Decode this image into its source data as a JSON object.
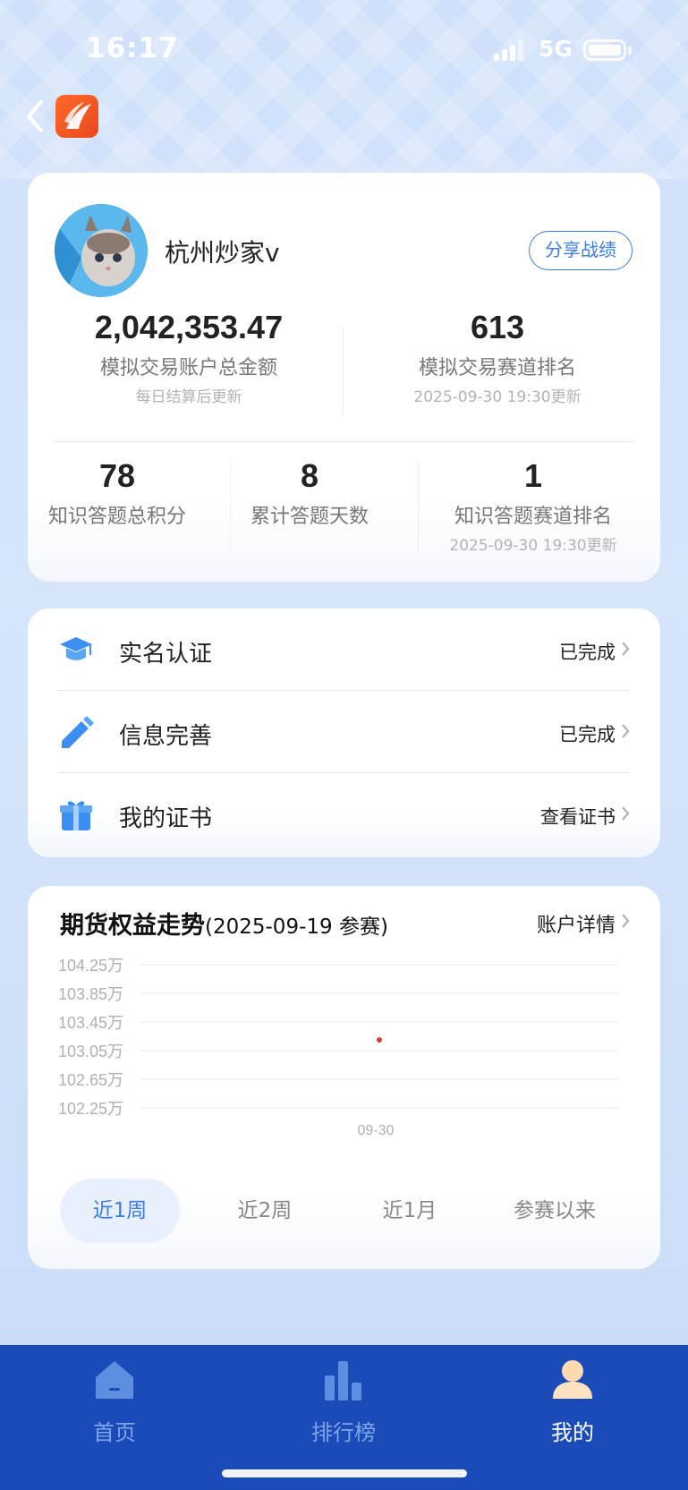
{
  "status": {
    "time": "16:17",
    "network": "5G"
  },
  "profile": {
    "username": "杭州炒家v",
    "share_label": "分享战绩"
  },
  "stats_top": [
    {
      "value": "2,042,353.47",
      "label": "模拟交易账户总金额",
      "note": "每日结算后更新"
    },
    {
      "value": "613",
      "label": "模拟交易赛道排名",
      "note": "2025-09-30 19:30更新"
    }
  ],
  "stats_bottom": [
    {
      "value": "78",
      "label": "知识答题总积分"
    },
    {
      "value": "8",
      "label": "累计答题天数"
    },
    {
      "value": "1",
      "label": "知识答题赛道排名",
      "note": "2025-09-30 19:30更新"
    }
  ],
  "menu": [
    {
      "label": "实名认证",
      "value": "已完成",
      "icon": "graduation-cap-icon"
    },
    {
      "label": "信息完善",
      "value": "已完成",
      "icon": "pencil-icon"
    },
    {
      "label": "我的证书",
      "value": "查看证书",
      "icon": "gift-icon"
    }
  ],
  "chart_section": {
    "title": "期货权益走势",
    "subtitle": "(2025-09-19 参赛)",
    "detail_link": "账户详情",
    "periods": [
      "近1周",
      "近2周",
      "近1月",
      "参赛以来"
    ],
    "active_period": "近1周",
    "accent": "#3c7ce8"
  },
  "chart_data": {
    "type": "scatter",
    "title": "",
    "xlabel": "",
    "ylabel": "",
    "categories": [
      "09-30"
    ],
    "y_ticks": [
      "104.25万",
      "103.85万",
      "103.45万",
      "103.05万",
      "102.65万",
      "102.25万"
    ],
    "ylim": [
      102.25,
      104.25
    ],
    "unit": "万",
    "series": [
      {
        "x": [
          "09-30"
        ],
        "values": [
          103.2
        ],
        "color": "#d43b3b"
      }
    ],
    "grid": true
  },
  "tabbar": [
    {
      "label": "首页",
      "icon": "home-icon",
      "active": false
    },
    {
      "label": "排行榜",
      "icon": "bar-chart-icon",
      "active": false
    },
    {
      "label": "我的",
      "icon": "user-icon",
      "active": true
    }
  ]
}
